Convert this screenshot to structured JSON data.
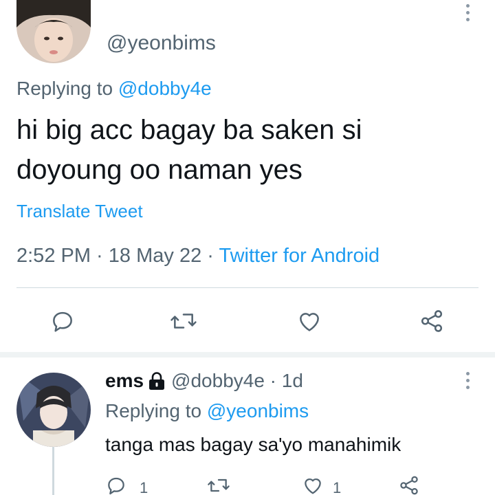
{
  "main_tweet": {
    "handle": "@yeonbims",
    "replying_prefix": "Replying to ",
    "replying_to": "@dobby4e",
    "text": "hi big acc bagay ba saken si doyoung oo naman yes",
    "translate_label": "Translate Tweet",
    "time": "2:52 PM",
    "date": "18 May 22",
    "separator": " · ",
    "source": "Twitter for Android",
    "more_icon": "more-vertical-icon"
  },
  "actions": {
    "reply_icon": "reply-icon",
    "retweet_icon": "retweet-icon",
    "like_icon": "like-icon",
    "share_icon": "share-icon"
  },
  "reply_tweet": {
    "name": "ems",
    "handle_time": "@dobby4e · 1d",
    "replying_prefix": "Replying to ",
    "replying_to": "@yeonbims",
    "text": "tanga mas bagay sa'yo manahimik",
    "reply_count": "1",
    "like_count": "1",
    "lock_icon": "lock-icon"
  },
  "colors": {
    "accent": "#1d9bf0",
    "secondary_text": "#536471",
    "primary_text": "#0f1419",
    "divider": "#cfd9de"
  }
}
